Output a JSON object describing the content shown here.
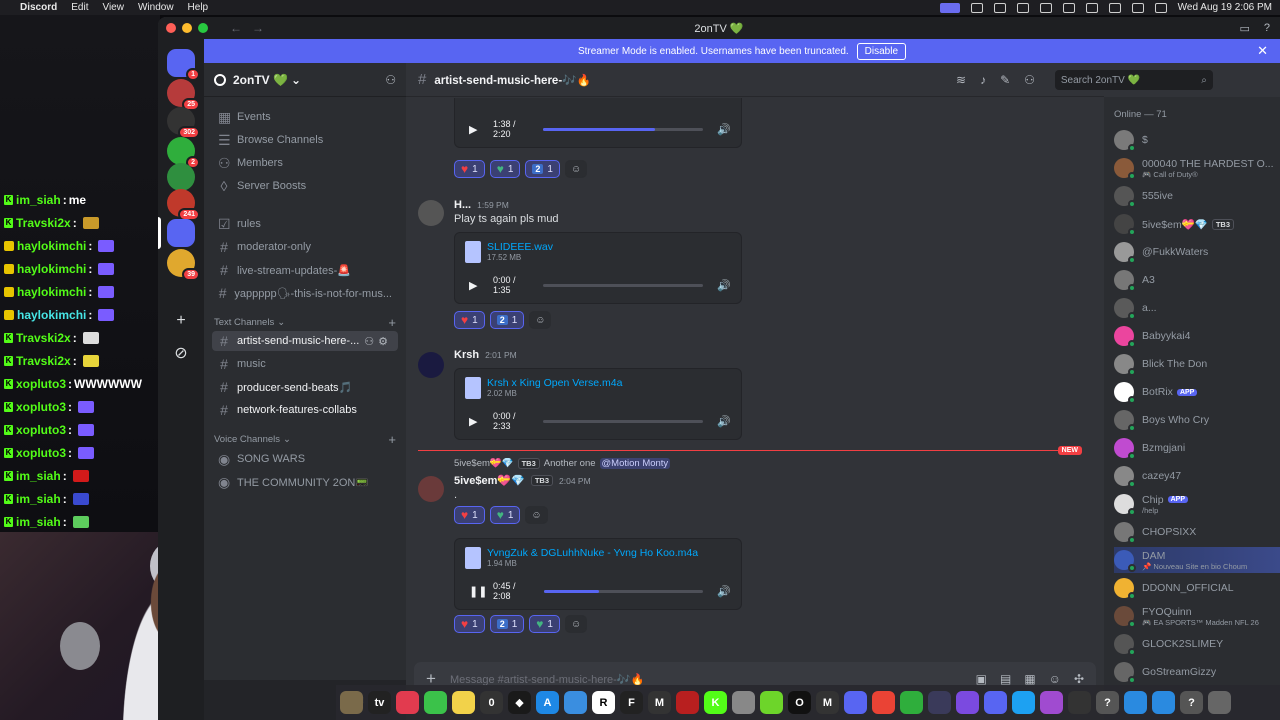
{
  "menubar": {
    "app": "Discord",
    "items": [
      "Edit",
      "View",
      "Window",
      "Help"
    ],
    "clock": "Wed Aug 19  2:06 PM"
  },
  "overlay_chat": [
    {
      "user": "im_siah",
      "msg": "me",
      "badge": "k",
      "style": "green"
    },
    {
      "user": "Travski2x",
      "msg": "",
      "badge": "k",
      "style": "green",
      "emote": "#c99a2a"
    },
    {
      "user": "haylokimchi",
      "msg": "",
      "badge": "y",
      "style": "green",
      "emote": "#7a5cff"
    },
    {
      "user": "haylokimchi",
      "msg": "",
      "badge": "y",
      "style": "green",
      "emote": "#7a5cff"
    },
    {
      "user": "haylokimchi",
      "msg": "",
      "badge": "y",
      "style": "green",
      "emote": "#7a5cff"
    },
    {
      "user": "haylokimchi",
      "msg": "",
      "badge": "y",
      "style": "cyan",
      "emote": "#7a5cff"
    },
    {
      "user": "Travski2x",
      "msg": "",
      "badge": "k",
      "style": "green",
      "emote": "#dddddd"
    },
    {
      "user": "Travski2x",
      "msg": "",
      "badge": "k",
      "style": "green",
      "emote": "#e7d43a"
    },
    {
      "user": "xoplutо3",
      "msg": "WWWWWW",
      "badge": "k",
      "style": "green"
    },
    {
      "user": "xoplutо3",
      "msg": "",
      "badge": "k",
      "style": "green",
      "emote": "#7a5cff"
    },
    {
      "user": "xoplutо3",
      "msg": "",
      "badge": "k",
      "style": "green",
      "emote": "#7a5cff"
    },
    {
      "user": "xoplutо3",
      "msg": "",
      "badge": "k",
      "style": "green",
      "emote": "#7a5cff"
    },
    {
      "user": "im_siah",
      "msg": "",
      "badge": "k",
      "style": "green",
      "emote": "#d21a1a"
    },
    {
      "user": "im_siah",
      "msg": "",
      "badge": "k",
      "style": "green",
      "emote": "#3a4ad0"
    },
    {
      "user": "im_siah",
      "msg": "",
      "badge": "k",
      "style": "green",
      "emote": "#5dcc5d"
    }
  ],
  "window": {
    "title": "2onTV 💚"
  },
  "streamer_banner": {
    "text": "Streamer Mode is enabled. Usernames have been truncated.",
    "button": "Disable"
  },
  "rail": [
    {
      "color": "#5865f2",
      "count": "1",
      "icon": "discord-icon"
    },
    {
      "color": "#b63b3b",
      "count": "25"
    },
    {
      "color": "#333333",
      "count": "302"
    },
    {
      "color": "#2fae3c",
      "count": "2"
    },
    {
      "color": "#2f8f3f",
      "count": ""
    },
    {
      "color": "#c0392b",
      "count": "241"
    },
    {
      "color": "#5865f2",
      "count": ""
    },
    {
      "color": "#e0a82e",
      "count": "39"
    }
  ],
  "sidebar": {
    "server_name": "2onTV 💚",
    "top_items": [
      "Events",
      "Browse Channels",
      "Members",
      "Server Boosts"
    ],
    "channels_top": [
      "rules",
      "moderator-only",
      "live-stream-updates-🚨",
      "yappppp🗣-this-is-not-for-mus..."
    ],
    "text_category": "Text Channels",
    "text_channels": [
      "artist-send-music-here-...",
      "music",
      "producer-send-beats🎵",
      "network-features-collabs"
    ],
    "voice_category": "Voice Channels",
    "voice_channels": [
      "SONG WARS",
      "THE COMMUNITY 2ON📟"
    ]
  },
  "main": {
    "channel": "artist-send-music-here-🎶🔥",
    "search_placeholder": "Search 2onTV 💚",
    "composer_placeholder": "Message #artist-send-music-here-🎶🔥",
    "msg0": {
      "time": "1:38 / 2:20",
      "progress": 0.7,
      "reactions": [
        {
          "kind": "heart",
          "n": "1"
        },
        {
          "kind": "gheart",
          "n": "1"
        },
        {
          "kind": "two",
          "n": "1"
        }
      ]
    },
    "msg1": {
      "author": "H...",
      "time": "1:59 PM",
      "text": "Play ts again pls mud",
      "file": "SLIDEEE.wav",
      "size": "17.52 MB",
      "player": "0:00 / 1:35",
      "progress": 0.0,
      "reactions": [
        {
          "kind": "heart",
          "n": "1"
        },
        {
          "kind": "two",
          "n": "1"
        }
      ]
    },
    "msg2": {
      "author": "Krsh",
      "time": "2:01 PM",
      "file": "Krsh x King Open Verse.m4a",
      "size": "2.02 MB",
      "player": "0:00 / 2:33",
      "progress": 0.0
    },
    "new_badge": "NEW",
    "msg3": {
      "reply_user": "5ive$em💝💎",
      "reply_tag": "TB3",
      "reply_text": "Another one",
      "reply_mention": "@Motion Monty",
      "author": "5ive$em💝💎",
      "tag": "TB3",
      "time": "2:04 PM",
      "text": ".",
      "reactions": [
        {
          "kind": "heart",
          "n": "1"
        },
        {
          "kind": "gheart",
          "n": "1"
        }
      ]
    },
    "msg4": {
      "file": "YvngZuk & DGLuhhNuke - Yvng Ho Koo.m4a",
      "size": "1.94 MB",
      "player": "0:45 / 2:08",
      "progress": 0.35,
      "reactions": [
        {
          "kind": "heart",
          "n": "1"
        },
        {
          "kind": "two",
          "n": "1"
        },
        {
          "kind": "gheart",
          "n": "1"
        }
      ]
    }
  },
  "members": {
    "category": "Online — 71",
    "list": [
      {
        "name": "$",
        "sub": "",
        "color": "#7a7a7a"
      },
      {
        "name": "000040 THE HARDEST O...",
        "sub": "🎮 Call of Duty®",
        "color": "#8a5a3a"
      },
      {
        "name": "555ive",
        "sub": "",
        "color": "#555"
      },
      {
        "name": "5ive$em💝💎",
        "sub": "",
        "color": "#444",
        "tag": "TB3"
      },
      {
        "name": "@FukkWaters",
        "sub": "",
        "color": "#999"
      },
      {
        "name": "A3",
        "sub": "",
        "color": "#777"
      },
      {
        "name": "a...",
        "sub": "",
        "color": "#5a5a5a"
      },
      {
        "name": "Babyykai4",
        "sub": "",
        "color": "#eb459e"
      },
      {
        "name": "Blick The Don",
        "sub": "",
        "color": "#888"
      },
      {
        "name": "BotRix",
        "sub": "",
        "color": "#fff",
        "app": "APP"
      },
      {
        "name": "Boys Who Cry",
        "sub": "",
        "color": "#666"
      },
      {
        "name": "Bzmgjani",
        "sub": "",
        "color": "#c04bd0"
      },
      {
        "name": "cazey47",
        "sub": "",
        "color": "#888"
      },
      {
        "name": "Chip",
        "sub": "/help",
        "color": "#ddd",
        "app": "APP"
      },
      {
        "name": "CHOPSIXX",
        "sub": "",
        "color": "#777"
      },
      {
        "name": "DAM",
        "sub": "📌 Nouveau Site en bio Choum",
        "color": "#3b5bb8",
        "hl": true
      },
      {
        "name": "DDONN_OFFICIAL",
        "sub": "",
        "color": "#f0b232"
      },
      {
        "name": "FYOQuinn",
        "sub": "🎮 EA SPORTS™ Madden NFL 26",
        "color": "#6a4a3a"
      },
      {
        "name": "GLOCK2SLIMEY",
        "sub": "",
        "color": "#555"
      },
      {
        "name": "GoStreamGizzy",
        "sub": "",
        "color": "#666"
      }
    ]
  },
  "dock": [
    {
      "color": "#7a6a4a",
      "label": ""
    },
    {
      "color": "#222",
      "label": "tv"
    },
    {
      "color": "#e23b4f",
      "label": ""
    },
    {
      "color": "#3bc24a",
      "label": ""
    },
    {
      "color": "#f2d24a",
      "label": ""
    },
    {
      "color": "#333",
      "label": "0"
    },
    {
      "color": "#1a1a1a",
      "label": "◆"
    },
    {
      "color": "#1e88e5",
      "label": "A"
    },
    {
      "color": "#3a8ee0",
      "label": ""
    },
    {
      "color": "#fff",
      "label": "R"
    },
    {
      "color": "#222",
      "label": "F"
    },
    {
      "color": "#333",
      "label": "M"
    },
    {
      "color": "#b81f1f",
      "label": ""
    },
    {
      "color": "#53fc18",
      "label": "K"
    },
    {
      "color": "#888",
      "label": ""
    },
    {
      "color": "#6dd52a",
      "label": ""
    },
    {
      "color": "#111",
      "label": "O"
    },
    {
      "color": "#333",
      "label": "M"
    },
    {
      "color": "#5865f2",
      "label": ""
    },
    {
      "color": "#ea4335",
      "label": ""
    },
    {
      "color": "#2fae3c",
      "label": ""
    },
    {
      "color": "#3a3a5a",
      "label": ""
    },
    {
      "color": "#7b4ae0",
      "label": ""
    },
    {
      "color": "#5865f2",
      "label": ""
    },
    {
      "color": "#1da1f2",
      "label": ""
    },
    {
      "color": "#a04bd0",
      "label": ""
    },
    {
      "color": "#333",
      "label": ""
    },
    {
      "color": "#555",
      "label": "?"
    },
    {
      "color": "#2a8ae0",
      "label": ""
    },
    {
      "color": "#2a8ae0",
      "label": ""
    },
    {
      "color": "#555",
      "label": "?"
    },
    {
      "color": "#666",
      "label": ""
    }
  ]
}
